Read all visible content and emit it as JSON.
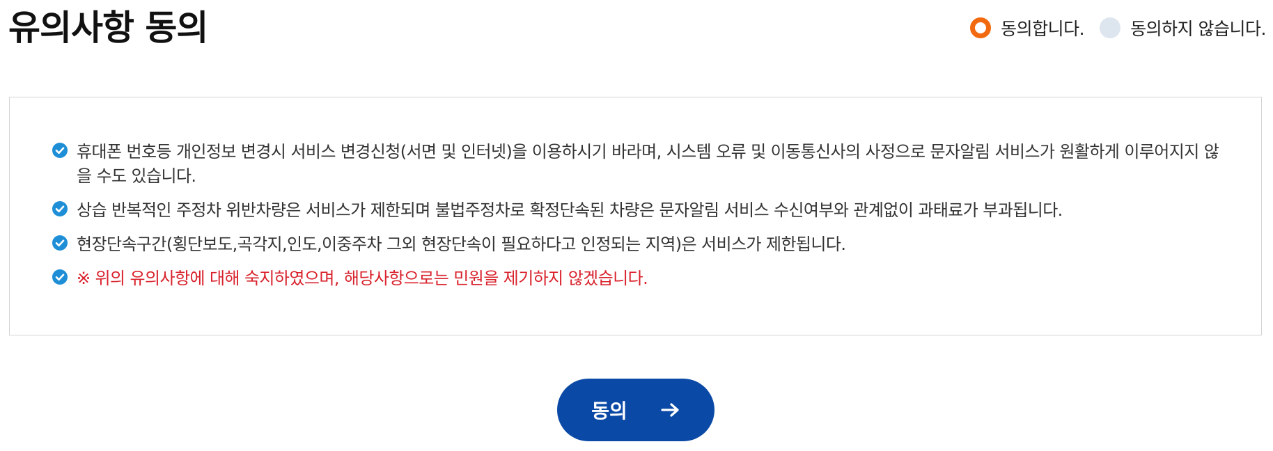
{
  "header": {
    "title": "유의사항 동의"
  },
  "agreement": {
    "agree_label": "동의합니다.",
    "disagree_label": "동의하지 않습니다.",
    "selected": "agree"
  },
  "notices": [
    {
      "text": "휴대폰 번호등 개인정보 변경시 서비스 변경신청(서면 및 인터넷)을 이용하시기 바라며, 시스템 오류 및 이동통신사의 사정으로 문자알림 서비스가 원활하게 이루어지지 않을 수도 있습니다."
    },
    {
      "text": "상습 반복적인 주정차 위반차량은 서비스가 제한되며 불법주정차로 확정단속된 차량은 문자알림 서비스 수신여부와 관계없이 과태료가 부과됩니다."
    },
    {
      "text": "현장단속구간(횡단보도,곡각지,인도,이중주차 그외 현장단속이 필요하다고 인정되는 지역)은 서비스가 제한됩니다."
    },
    {
      "text": "※ 위의 유의사항에 대해 숙지하였으며, 해당사항으로는 민원을 제기하지 않겠습니다."
    }
  ],
  "button": {
    "label": "동의"
  },
  "icons": {
    "check": "check-circle-icon",
    "arrow": "arrow-right-icon"
  },
  "colors": {
    "accent_orange": "#f26a0f",
    "radio_unchecked": "#dde5ef",
    "check_blue": "#1e8fd6",
    "button_blue": "#0a4aa6",
    "warning_red": "#d9232d"
  }
}
